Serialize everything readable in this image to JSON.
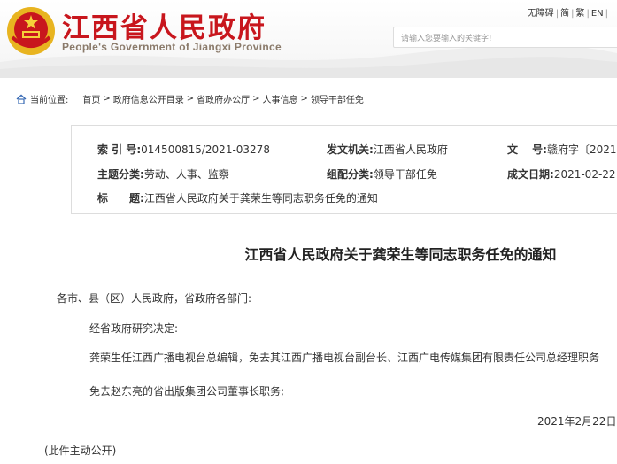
{
  "header": {
    "title": "江西省人民政府",
    "subtitle": "People's Government of Jiangxi Province",
    "toplinks": [
      "无障碍",
      "简",
      "繁",
      "EN"
    ],
    "search_placeholder": "请输入您要输入的关键字!",
    "colors": {
      "brand_red": "#c8161d",
      "emblem_gold": "#e8b420"
    }
  },
  "breadcrumb": {
    "label": "当前位置:",
    "items": [
      "首页",
      "政府信息公开目录",
      "省政府办公厅",
      "人事信息",
      "领导干部任免"
    ]
  },
  "meta": {
    "index_label": "索 引 号:",
    "index_value": "014500815/2021-03278",
    "issuer_label": "发文机关:",
    "issuer_value": "江西省人民政府",
    "docno_label": "文　 号:",
    "docno_value": "赣府字〔2021",
    "topic_label": "主题分类:",
    "topic_value": "劳动、人事、监察",
    "category_label": "组配分类:",
    "category_value": "领导干部任免",
    "date_label": "成文日期:",
    "date_value": "2021-02-22",
    "title_label": "标　　题:",
    "title_value": "江西省人民政府关于龚荣生等同志职务任免的通知"
  },
  "document": {
    "title": "江西省人民政府关于龚荣生等同志职务任免的通知",
    "salutation": "各市、县（区）人民政府，省政府各部门:",
    "p1": "经省政府研究决定:",
    "p2": "龚荣生任江西广播电视台总编辑，免去其江西广播电视台副台长、江西广电传媒集团有限责任公司总经理职务",
    "p3": "免去赵东亮的省出版集团公司董事长职务;",
    "date": "2021年2月22日",
    "note": "(此件主动公开)"
  }
}
